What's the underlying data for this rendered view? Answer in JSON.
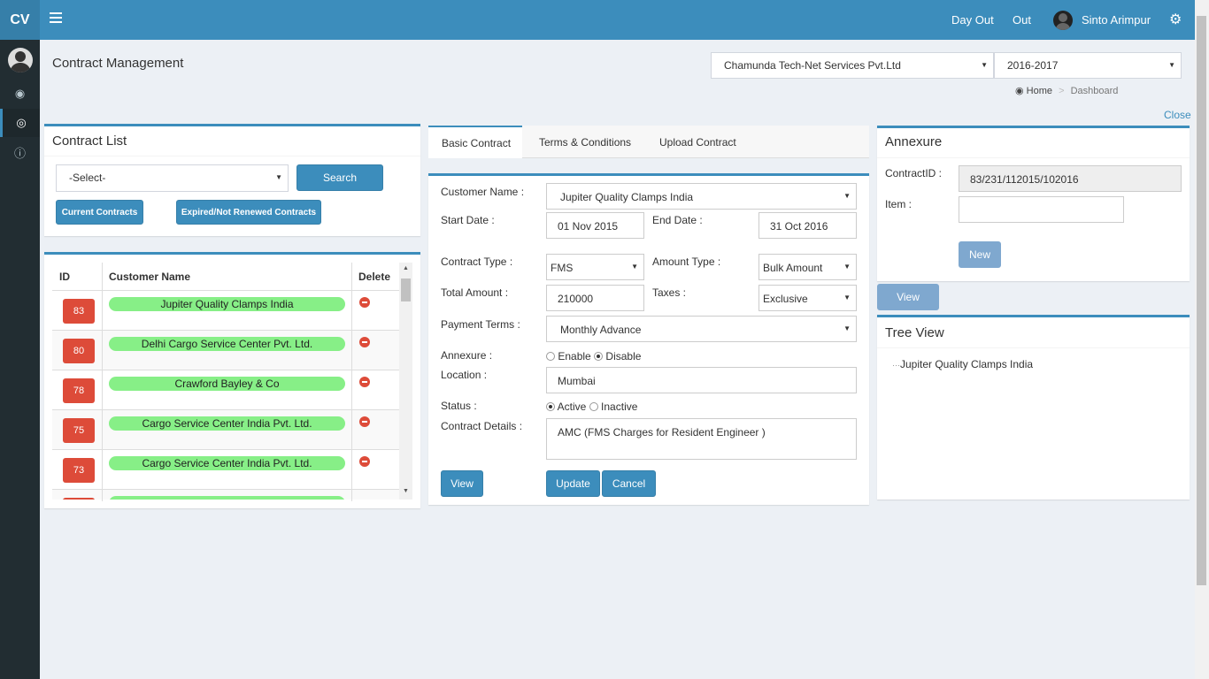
{
  "header": {
    "logo": "CV",
    "day_out": "Day Out",
    "out": "Out",
    "user_name": "Sinto Arimpur"
  },
  "page": {
    "title": "Contract Management",
    "company": "Chamunda Tech-Net Services Pvt.Ltd",
    "year": "2016-2017",
    "breadcrumb_home": "Home",
    "breadcrumb_current": "Dashboard",
    "close": "Close"
  },
  "contract_list": {
    "title": "Contract List",
    "select_value": "-Select-",
    "search": "Search",
    "current_contracts": "Current Contracts",
    "expired_contracts": "Expired/Not Renewed Contracts",
    "columns": [
      "ID",
      "Customer Name",
      "Delete"
    ],
    "rows": [
      {
        "id": "83",
        "name": "Jupiter Quality Clamps India"
      },
      {
        "id": "80",
        "name": "Delhi Cargo Service Center Pvt. Ltd."
      },
      {
        "id": "78",
        "name": "Crawford Bayley & Co"
      },
      {
        "id": "75",
        "name": "Cargo Service Center India Pvt. Ltd."
      },
      {
        "id": "73",
        "name": "Cargo Service Center India Pvt. Ltd."
      }
    ]
  },
  "tabs": [
    "Basic Contract",
    "Terms & Conditions",
    "Upload Contract"
  ],
  "form": {
    "customer_name_label": "Customer Name :",
    "customer_name": "Jupiter Quality Clamps India",
    "start_date_label": "Start Date :",
    "start_date": "01 Nov 2015",
    "end_date_label": "End Date :",
    "end_date": "31 Oct 2016",
    "contract_type_label": "Contract Type :",
    "contract_type": "FMS",
    "amount_type_label": "Amount Type :",
    "amount_type": "Bulk Amount",
    "total_amount_label": "Total Amount :",
    "total_amount": "210000",
    "taxes_label": "Taxes :",
    "taxes": "Exclusive",
    "payment_terms_label": "Payment Terms :",
    "payment_terms": "Monthly Advance",
    "annexure_label": "Annexure :",
    "enable": "Enable",
    "disable": "Disable",
    "location_label": "Location :",
    "location": "Mumbai",
    "status_label": "Status :",
    "active": "Active",
    "inactive": "Inactive",
    "details_label": "Contract Details :",
    "details": "AMC (FMS Charges for Resident Engineer )",
    "view": "View",
    "update": "Update",
    "cancel": "Cancel"
  },
  "annexure": {
    "title": "Annexure",
    "contract_id_label": "ContractID :",
    "contract_id": "83/231/112015/102016",
    "item_label": "Item :",
    "new": "New",
    "view": "View"
  },
  "tree_view": {
    "title": "Tree View",
    "node": "Jupiter Quality Clamps India"
  },
  "colors": {
    "primary": "#3c8dbc",
    "sidebar": "#222d32",
    "danger": "#dd4b39",
    "pill": "#87ef87"
  }
}
